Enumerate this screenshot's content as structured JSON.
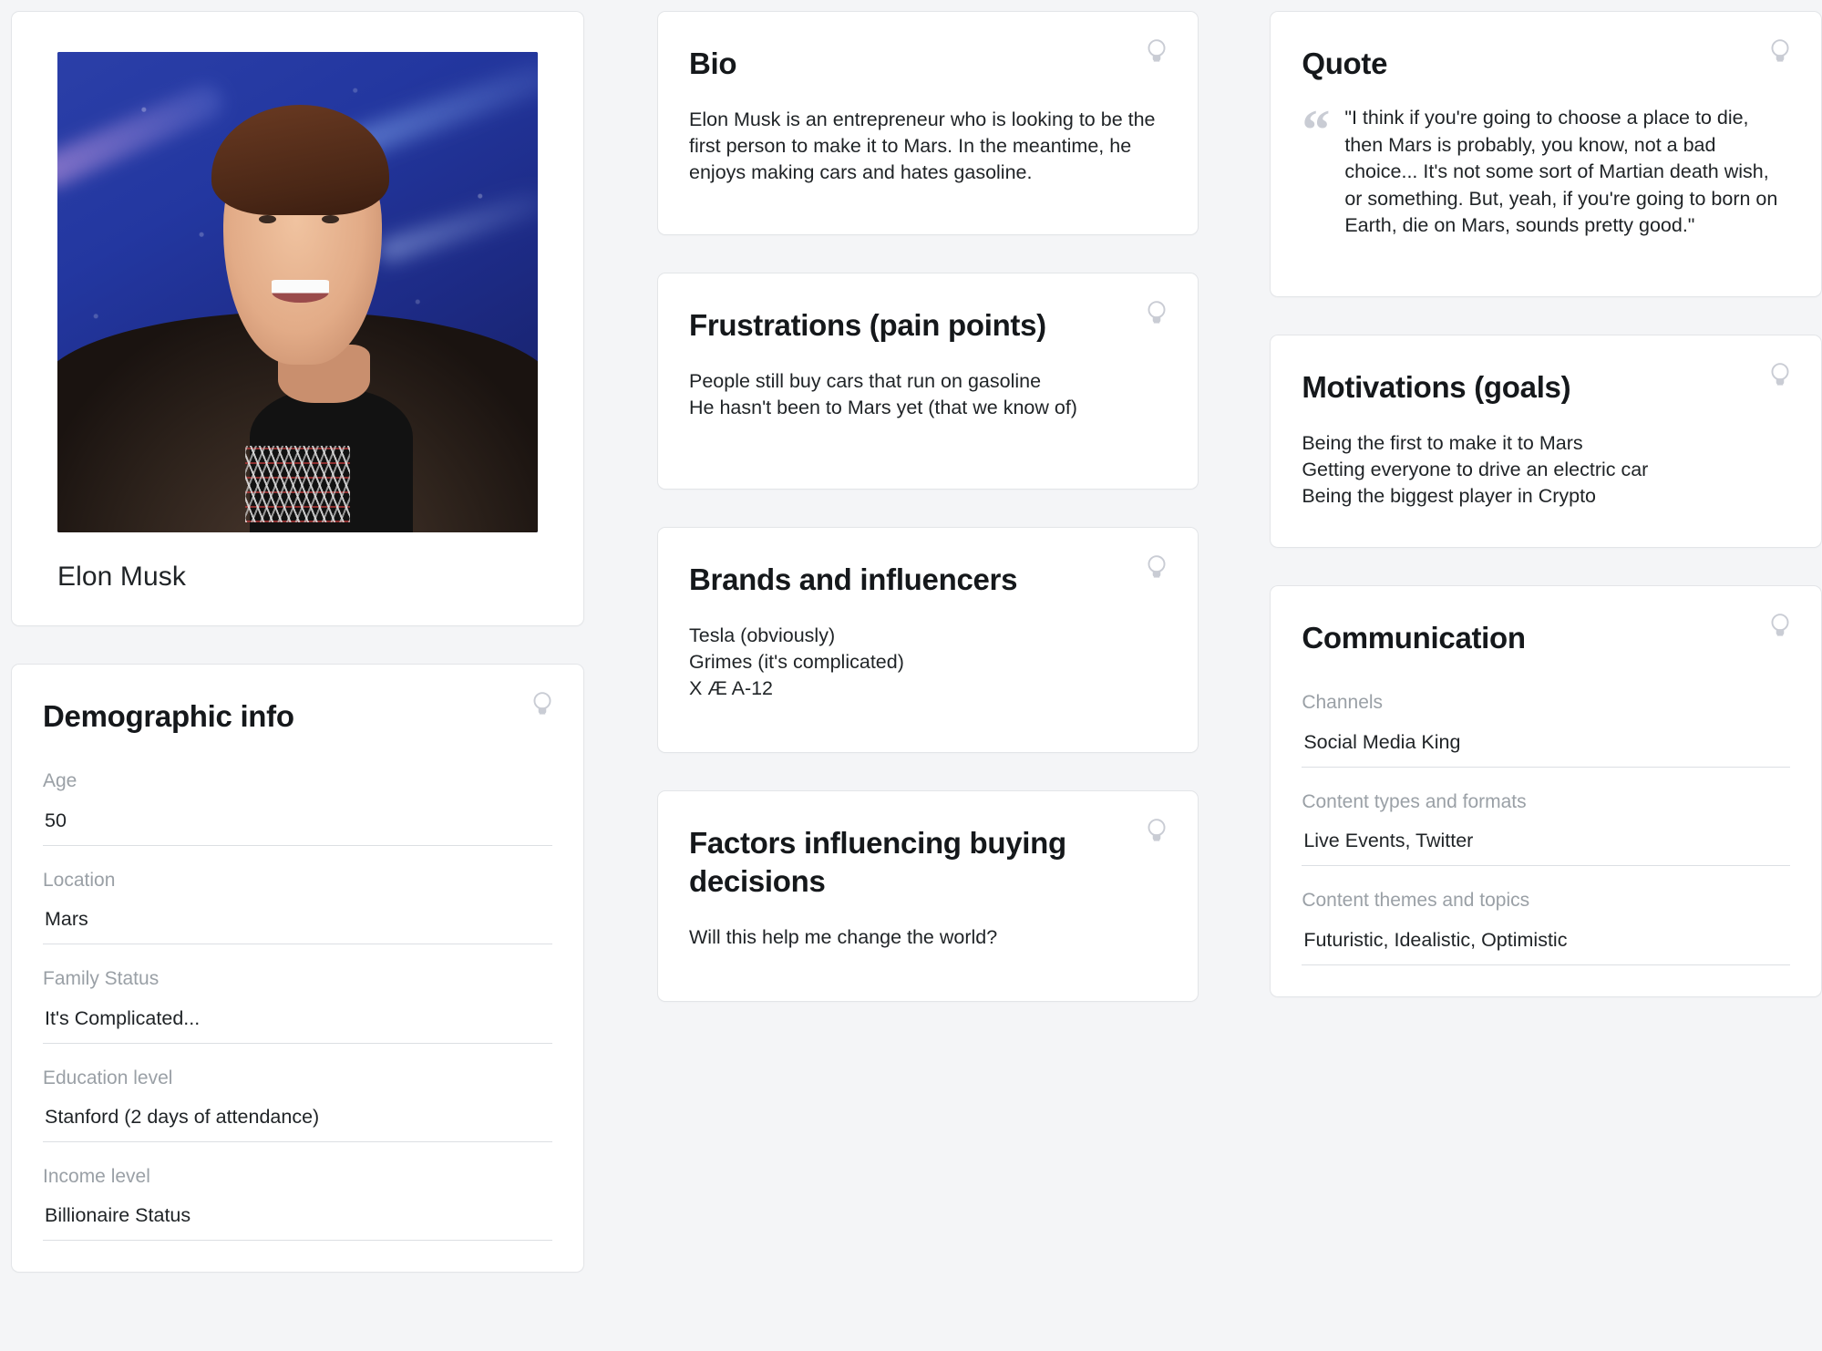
{
  "profile": {
    "name": "Elon Musk",
    "photo_alt": "portrait-photo"
  },
  "icons": {
    "bulb": "lightbulb-icon",
    "quote": "quote-mark-icon"
  },
  "cards": {
    "bio": {
      "title": "Bio",
      "body": "Elon Musk is an entrepreneur who is looking to be the first person to make it to Mars. In the meantime, he enjoys making cars and hates gasoline."
    },
    "frustrations": {
      "title": "Frustrations (pain points)",
      "body": "People still buy cars that run on gasoline\nHe hasn't been to Mars yet (that we know of)"
    },
    "brands": {
      "title": "Brands and influencers",
      "body": "Tesla (obviously)\nGrimes (it's complicated)\nX Æ A-12"
    },
    "factors": {
      "title": "Factors influencing buying decisions",
      "body": "Will this help me change the world?"
    },
    "quote": {
      "title": "Quote",
      "body": "\"I think if you're going to choose a place to die, then Mars is probably, you know, not a bad choice... It's not some sort of Martian death wish, or something. But, yeah, if you're going to born on Earth, die on Mars, sounds pretty good.\"",
      "mark": "“"
    },
    "motivations": {
      "title": "Motivations (goals)",
      "body": "Being the first to make it to Mars\nGetting everyone to drive an electric car\nBeing the biggest player in Crypto"
    },
    "demographic": {
      "title": "Demographic info",
      "fields": [
        {
          "label": "Age",
          "value": "50"
        },
        {
          "label": "Location",
          "value": "Mars"
        },
        {
          "label": "Family Status",
          "value": "It's Complicated..."
        },
        {
          "label": "Education level",
          "value": "Stanford (2 days of attendance)"
        },
        {
          "label": "Income level",
          "value": "Billionaire Status"
        }
      ]
    },
    "communication": {
      "title": "Communication",
      "fields": [
        {
          "label": "Channels",
          "value": "Social Media King"
        },
        {
          "label": "Content types and formats",
          "value": "Live Events, Twitter"
        },
        {
          "label": "Content themes and topics",
          "value": "Futuristic, Idealistic, Optimistic"
        }
      ]
    }
  },
  "colors": {
    "page_background": "#f4f5f7",
    "card_background": "#ffffff",
    "card_border": "#e3e5e8",
    "label_text": "#9aa0a6",
    "body_text": "#1f2326",
    "icon_gray": "#c9ccd4"
  }
}
